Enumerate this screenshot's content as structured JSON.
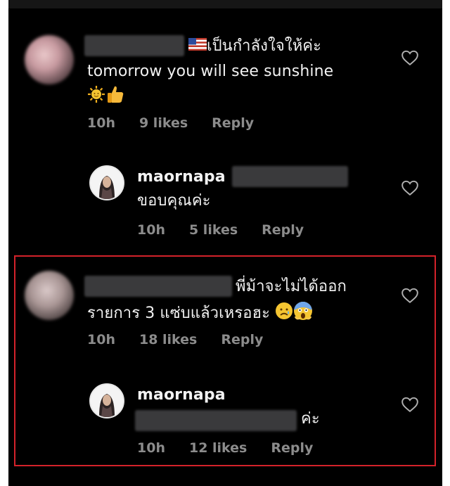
{
  "comments": [
    {
      "text_line1": "เป็นกำลังใจให้ค่ะ",
      "text_line2": "tomorrow you will see sunshine",
      "time": "10h",
      "likes": "9 likes",
      "reply": "Reply",
      "emoji_flag": "us-flag-icon",
      "emoji_line": [
        "sun-emoji",
        "thumbs-up-emoji"
      ],
      "reply_item": {
        "username": "maornapa",
        "text": "ขอบคุณค่ะ",
        "time": "10h",
        "likes": "5 likes",
        "reply": "Reply"
      }
    },
    {
      "text_line1": "พี่ม้าจะไม่ได้ออก",
      "text_line2": "รายการ 3 แซ่บแล้วเหรอฮะ",
      "time": "10h",
      "likes": "18 likes",
      "reply": "Reply",
      "emoji_line": [
        "sad-face-emoji",
        "screaming-face-emoji"
      ],
      "reply_item": {
        "username": "maornapa",
        "text": "ค่ะ",
        "time": "10h",
        "likes": "12 likes",
        "reply": "Reply"
      }
    }
  ],
  "colors": {
    "background": "#000000",
    "text": "#f2f2f2",
    "meta": "#8c8c8c",
    "highlight_border": "#d3222a"
  }
}
